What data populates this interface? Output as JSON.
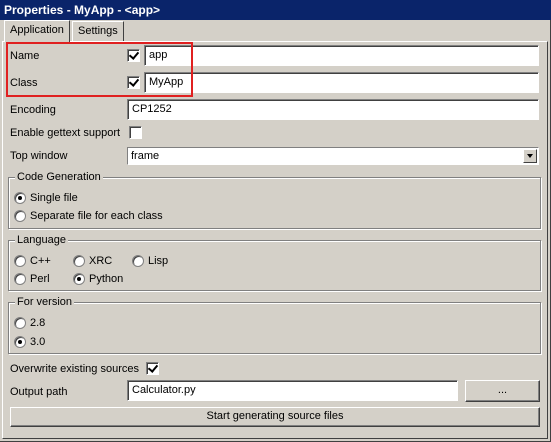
{
  "window": {
    "title": "Properties - MyApp - <app>"
  },
  "tabs": [
    {
      "label": "Application",
      "active": true
    },
    {
      "label": "Settings",
      "active": false
    }
  ],
  "fields": {
    "name": {
      "label": "Name",
      "checked": true,
      "value": "app"
    },
    "class": {
      "label": "Class",
      "checked": true,
      "value": "MyApp"
    },
    "encoding": {
      "label": "Encoding",
      "value": "CP1252"
    },
    "gettext": {
      "label": "Enable gettext support",
      "checked": false
    },
    "top_window": {
      "label": "Top window",
      "selected": "frame"
    }
  },
  "code_generation": {
    "title": "Code Generation",
    "options": [
      {
        "label": "Single file",
        "checked": true
      },
      {
        "label": "Separate file for each class",
        "checked": false
      }
    ]
  },
  "language": {
    "title": "Language",
    "options": [
      {
        "label": "C++",
        "checked": false
      },
      {
        "label": "XRC",
        "checked": false
      },
      {
        "label": "Lisp",
        "checked": false
      },
      {
        "label": "Perl",
        "checked": false
      },
      {
        "label": "Python",
        "checked": true
      }
    ]
  },
  "for_version": {
    "title": "For version",
    "options": [
      {
        "label": "2.8",
        "checked": false
      },
      {
        "label": "3.0",
        "checked": true
      }
    ]
  },
  "overwrite": {
    "label": "Overwrite existing sources",
    "checked": true
  },
  "output": {
    "label": "Output path",
    "value": "Calculator.py",
    "browse_label": "..."
  },
  "generate_button": {
    "label": "Start generating source files"
  },
  "colors": {
    "titlebar": "#0a246a",
    "highlight": "#e02020",
    "face": "#d4d0c8"
  }
}
